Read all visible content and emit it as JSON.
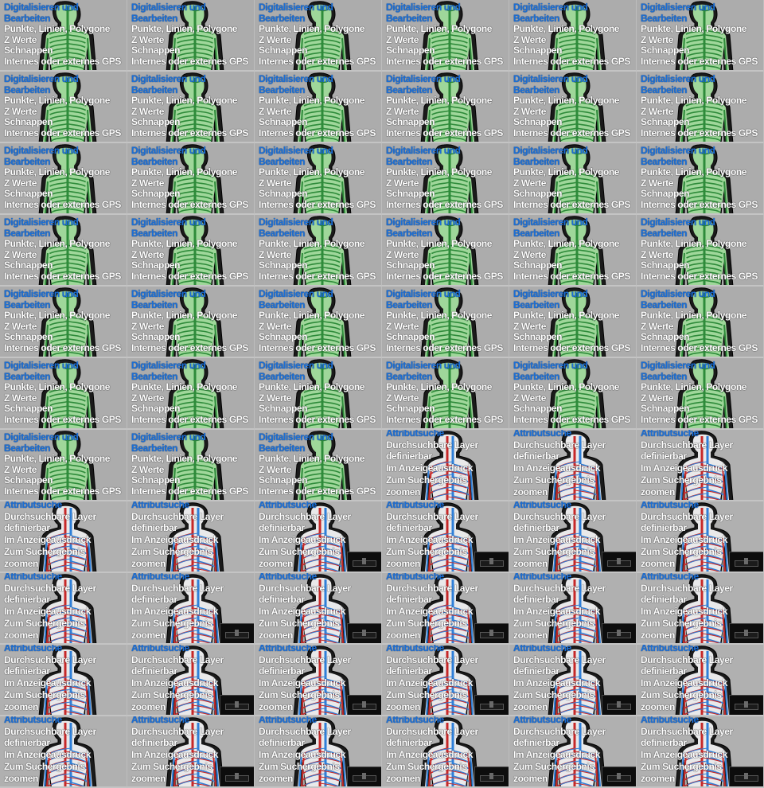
{
  "slides": {
    "a": {
      "title": "Digitalisieren und Bearbeiten",
      "lines": [
        "Punkte, Linien, Polygone",
        "Z Werte",
        "Schnappen",
        "Internes oder externes GPS"
      ]
    },
    "b": {
      "title": "Attributsuche",
      "lines": [
        "Durchsuchbare Layer definierbar",
        "Im Anzeigeausdruck",
        "Zum Suchergebnis zoomen"
      ]
    }
  },
  "colors": {
    "title": "#1b6fd6",
    "text": "#ffffff",
    "figure_outline": "#111111",
    "nerve_green": "#2e8b3a",
    "artery_red": "#c62828",
    "vein_blue": "#2f7fd8"
  },
  "icons": {
    "a": "human-figure-nervous-system-icon",
    "b": "human-figure-circulatory-system-icon",
    "inset": "video-thumbnail"
  },
  "tiles": [
    "a",
    "a",
    "a",
    "a",
    "a",
    "a",
    "a",
    "a",
    "a",
    "a",
    "a",
    "a",
    "a",
    "a",
    "a",
    "a",
    "a",
    "a",
    "a",
    "a",
    "a",
    "a",
    "a",
    "a",
    "a",
    "a",
    "a",
    "a",
    "a",
    "a",
    "a",
    "a",
    "a",
    "a",
    "a",
    "a",
    "a",
    "a",
    "a",
    "b",
    "b",
    "b",
    "b",
    "b",
    "b",
    "b",
    "b",
    "b",
    "b",
    "b",
    "b",
    "b",
    "b",
    "b",
    "b",
    "b",
    "b",
    "b",
    "b",
    "b",
    "b",
    "b",
    "b",
    "b",
    "b",
    "b"
  ],
  "insets": [
    false,
    false,
    false,
    false,
    false,
    false,
    false,
    false,
    false,
    false,
    false,
    false,
    false,
    false,
    false,
    false,
    false,
    false,
    false,
    false,
    false,
    false,
    false,
    false,
    false,
    false,
    false,
    false,
    false,
    false,
    false,
    false,
    false,
    false,
    false,
    false,
    false,
    false,
    false,
    false,
    false,
    false,
    false,
    false,
    true,
    true,
    true,
    true,
    false,
    true,
    true,
    true,
    true,
    true,
    false,
    true,
    true,
    true,
    true,
    true,
    false,
    true,
    true,
    true,
    true,
    true
  ]
}
